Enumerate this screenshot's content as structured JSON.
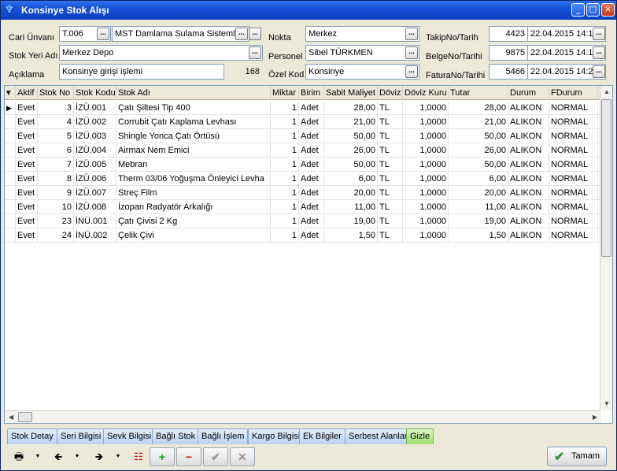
{
  "window": {
    "title": "Konsinye Stok Alışı"
  },
  "form": {
    "cari_unvani_label": "Cari Ünvanı",
    "cari_code": "T.006",
    "cari_name": "MST Damlama Sulama Sistemleri",
    "stok_yeri_label": "Stok Yeri Adı",
    "stok_yeri": "Merkez Depo",
    "aciklama_label": "Açıklama",
    "aciklama": "Konsinye girişi işlemi",
    "aciklama_count": "168",
    "nokta_label": "Nokta",
    "nokta": "Merkez",
    "personel_label": "Personel",
    "personel": "Sibel TÜRKMEN",
    "ozel_kod_label": "Özel Kod",
    "ozel_kod": "Konsinye",
    "takip_label": "TakipNo/Tarih",
    "takip_no": "4423",
    "takip_tarih": "22.04.2015 14:1",
    "belge_label": "BelgeNo/Tarihi",
    "belge_no": "9875",
    "belge_tarih": "22.04.2015 14:1",
    "fatura_label": "FaturaNo/Tarihi",
    "fatura_no": "5466",
    "fatura_tarih": "22.04.2015 14:2"
  },
  "grid": {
    "columns": [
      "Aktif",
      "Stok No",
      "Stok Kodu",
      "Stok Adı",
      "Miktar",
      "Birim",
      "Sabit Maliyet",
      "Döviz",
      "Döviz Kuru",
      "Tutar",
      "Durum",
      "FDurum"
    ],
    "rows": [
      [
        "Evet",
        "3",
        "İZÜ.001",
        "Çatı Şiltesi Tip 400",
        "1",
        "Adet",
        "28,00",
        "TL",
        "1,0000",
        "28,00",
        "ALIKON",
        "NORMAL"
      ],
      [
        "Evet",
        "4",
        "İZÜ.002",
        "Corrubit Çatı Kaplama Levhası",
        "1",
        "Adet",
        "21,00",
        "TL",
        "1,0000",
        "21,00",
        "ALIKON",
        "NORMAL"
      ],
      [
        "Evet",
        "5",
        "İZÜ.003",
        "Shingle Yonca Çatı Örtüsü",
        "1",
        "Adet",
        "50,00",
        "TL",
        "1,0000",
        "50,00",
        "ALIKON",
        "NORMAL"
      ],
      [
        "Evet",
        "6",
        "İZÜ.004",
        "Airmax Nem Emici",
        "1",
        "Adet",
        "26,00",
        "TL",
        "1,0000",
        "26,00",
        "ALIKON",
        "NORMAL"
      ],
      [
        "Evet",
        "7",
        "İZÜ.005",
        "Mebran",
        "1",
        "Adet",
        "50,00",
        "TL",
        "1,0000",
        "50,00",
        "ALIKON",
        "NORMAL"
      ],
      [
        "Evet",
        "8",
        "İZÜ.006",
        "Therm 03/06 Yoğuşma Önleyici Levha",
        "1",
        "Adet",
        "6,00",
        "TL",
        "1,0000",
        "6,00",
        "ALIKON",
        "NORMAL"
      ],
      [
        "Evet",
        "9",
        "İZÜ.007",
        "Streç Film",
        "1",
        "Adet",
        "20,00",
        "TL",
        "1,0000",
        "20,00",
        "ALIKON",
        "NORMAL"
      ],
      [
        "Evet",
        "10",
        "İZÜ.008",
        "İzopan Radyatör Arkalığı",
        "1",
        "Adet",
        "11,00",
        "TL",
        "1,0000",
        "11,00",
        "ALIKON",
        "NORMAL"
      ],
      [
        "Evet",
        "23",
        "İNÜ.001",
        "Çatı Çivisi 2 Kg",
        "1",
        "Adet",
        "19,00",
        "TL",
        "1,0000",
        "19,00",
        "ALIKON",
        "NORMAL"
      ],
      [
        "Evet",
        "24",
        "İNÜ.002",
        "Çelik Çivi",
        "1",
        "Adet",
        "1,50",
        "TL",
        "1,0000",
        "1,50",
        "ALIKON",
        "NORMAL"
      ]
    ]
  },
  "tabs": [
    "Stok Detay",
    "Seri Bilgisi",
    "Sevk Bilgisi",
    "Bağlı Stok",
    "Bağlı İşlem",
    "Kargo Bilgisi",
    "Ek Bilgiler",
    "Serbest Alanlar",
    "Gizle"
  ],
  "active_tab": "Gizle",
  "toolbar": {
    "ok_label": "Tamam",
    "ellipsis": "..."
  },
  "colors": {
    "title_bar": "#0a3fbd",
    "active_tab": "#9fe06a",
    "tab": "#b8d3f2"
  }
}
